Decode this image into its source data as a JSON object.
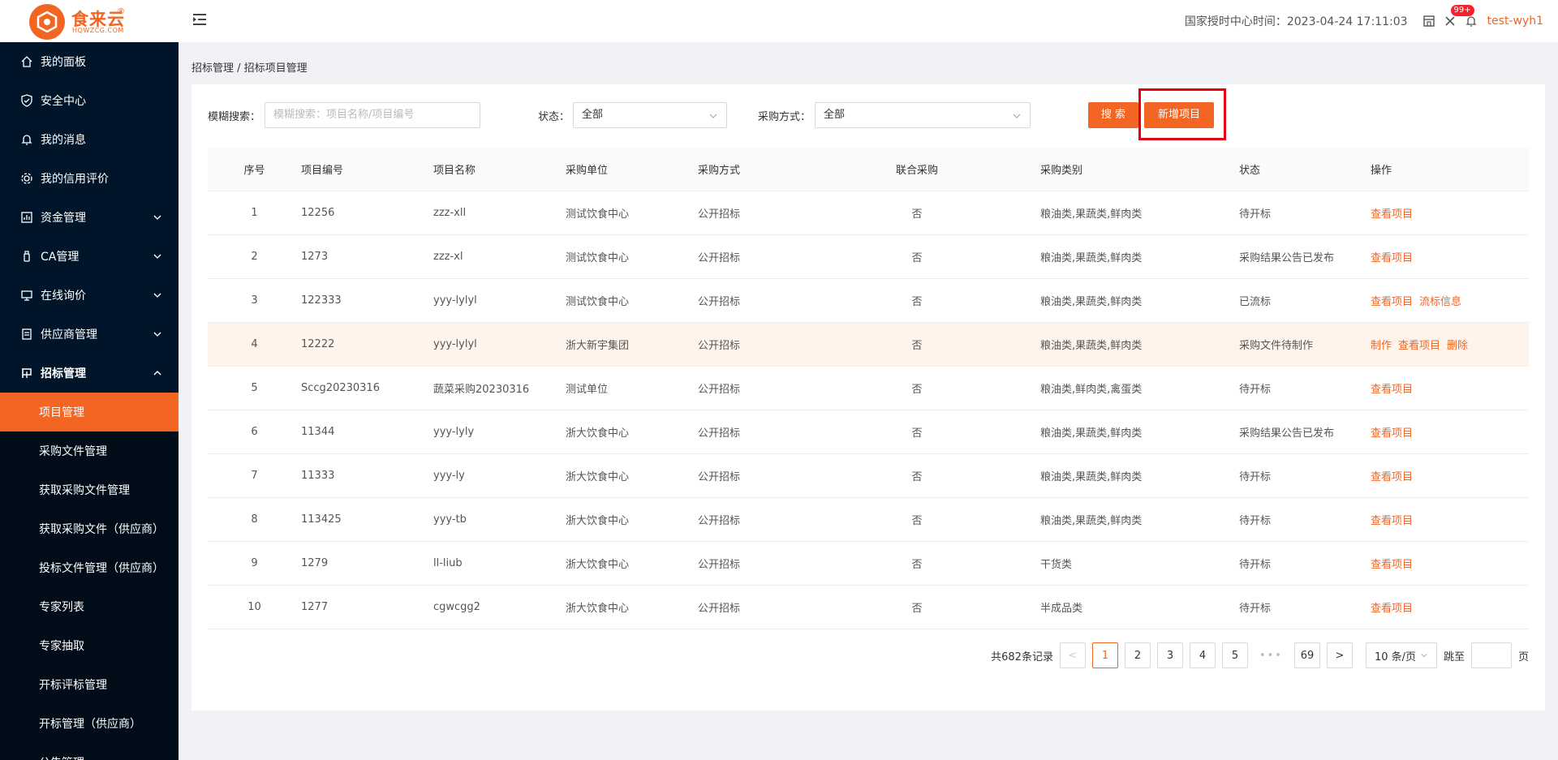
{
  "header": {
    "logo_text": "食来云",
    "logo_sub": "HQWZCG.COM",
    "logo_reg": "®",
    "time_label": "国家授时中心时间：2023-04-24 17:11:03",
    "badge": "99+",
    "username": "test-wyh1"
  },
  "sidebar": {
    "items": [
      {
        "label": "我的面板",
        "icon": "home-icon"
      },
      {
        "label": "安全中心",
        "icon": "shield-icon"
      },
      {
        "label": "我的消息",
        "icon": "bell-icon"
      },
      {
        "label": "我的信用评价",
        "icon": "gear-icon"
      },
      {
        "label": "资金管理",
        "icon": "fund-icon"
      },
      {
        "label": "CA管理",
        "icon": "usb-key-icon"
      },
      {
        "label": "在线询价",
        "icon": "screen-icon"
      },
      {
        "label": "供应商管理",
        "icon": "document-icon"
      },
      {
        "label": "招标管理",
        "icon": "flag-icon"
      }
    ],
    "sub_items": [
      "项目管理",
      "采购文件管理",
      "获取采购文件管理",
      "获取采购文件（供应商）",
      "投标文件管理（供应商）",
      "专家列表",
      "专家抽取",
      "开标评标管理",
      "开标管理（供应商）",
      "公告管理"
    ]
  },
  "breadcrumb": "招标管理 / 招标项目管理",
  "filters": {
    "fuzzy_label": "模糊搜索：",
    "fuzzy_placeholder": "模糊搜索：项目名称/项目编号",
    "status_label": "状态：",
    "status_value": "全部",
    "method_label": "采购方式：",
    "method_value": "全部",
    "search_button": "搜 索",
    "add_button": "新增项目"
  },
  "table": {
    "headers": [
      "序号",
      "项目编号",
      "项目名称",
      "采购单位",
      "采购方式",
      "联合采购",
      "采购类别",
      "状态",
      "操作"
    ],
    "rows": [
      {
        "no": "1",
        "code": "12256",
        "name": "zzz-xll",
        "unit": "测试饮食中心",
        "method": "公开招标",
        "joint": "否",
        "category": "粮油类,果蔬类,鲜肉类",
        "status": "待开标",
        "ops": [
          "查看项目"
        ]
      },
      {
        "no": "2",
        "code": "1273",
        "name": "zzz-xl",
        "unit": "测试饮食中心",
        "method": "公开招标",
        "joint": "否",
        "category": "粮油类,果蔬类,鲜肉类",
        "status": "采购结果公告已发布",
        "ops": [
          "查看项目"
        ]
      },
      {
        "no": "3",
        "code": "122333",
        "name": "yyy-lylyl",
        "unit": "测试饮食中心",
        "method": "公开招标",
        "joint": "否",
        "category": "粮油类,果蔬类,鲜肉类",
        "status": "已流标",
        "ops": [
          "查看项目",
          "流标信息"
        ]
      },
      {
        "no": "4",
        "code": "12222",
        "name": "yyy-lylyl",
        "unit": "浙大新宇集团",
        "method": "公开招标",
        "joint": "否",
        "category": "粮油类,果蔬类,鲜肉类",
        "status": "采购文件待制作",
        "ops": [
          "制作",
          "查看项目",
          "删除"
        ]
      },
      {
        "no": "5",
        "code": "Sccg20230316",
        "name": "蔬菜采购20230316",
        "unit": "测试单位",
        "method": "公开招标",
        "joint": "否",
        "category": "粮油类,鲜肉类,禽蛋类",
        "status": "待开标",
        "ops": [
          "查看项目"
        ]
      },
      {
        "no": "6",
        "code": "11344",
        "name": "yyy-lyly",
        "unit": "浙大饮食中心",
        "method": "公开招标",
        "joint": "否",
        "category": "粮油类,果蔬类,鲜肉类",
        "status": "采购结果公告已发布",
        "ops": [
          "查看项目"
        ]
      },
      {
        "no": "7",
        "code": "11333",
        "name": "yyy-ly",
        "unit": "浙大饮食中心",
        "method": "公开招标",
        "joint": "否",
        "category": "粮油类,果蔬类,鲜肉类",
        "status": "待开标",
        "ops": [
          "查看项目"
        ]
      },
      {
        "no": "8",
        "code": "113425",
        "name": "yyy-tb",
        "unit": "浙大饮食中心",
        "method": "公开招标",
        "joint": "否",
        "category": "粮油类,果蔬类,鲜肉类",
        "status": "待开标",
        "ops": [
          "查看项目"
        ]
      },
      {
        "no": "9",
        "code": "1279",
        "name": "ll-liub",
        "unit": "浙大饮食中心",
        "method": "公开招标",
        "joint": "否",
        "category": "干货类",
        "status": "待开标",
        "ops": [
          "查看项目"
        ]
      },
      {
        "no": "10",
        "code": "1277",
        "name": "cgwcgg2",
        "unit": "浙大饮食中心",
        "method": "公开招标",
        "joint": "否",
        "category": "半成品类",
        "status": "待开标",
        "ops": [
          "查看项目"
        ]
      }
    ]
  },
  "pagination": {
    "total": "共682条记录",
    "prev": "<",
    "pages": [
      "1",
      "2",
      "3",
      "4",
      "5"
    ],
    "ellipsis": "•••",
    "last": "69",
    "next": ">",
    "page_size": "10 条/页",
    "jump_label": "跳至",
    "page_suffix": "页"
  },
  "colors": {
    "brand": "#f26522",
    "sidebar_bg": "#001529",
    "highlight": "#e60012"
  }
}
